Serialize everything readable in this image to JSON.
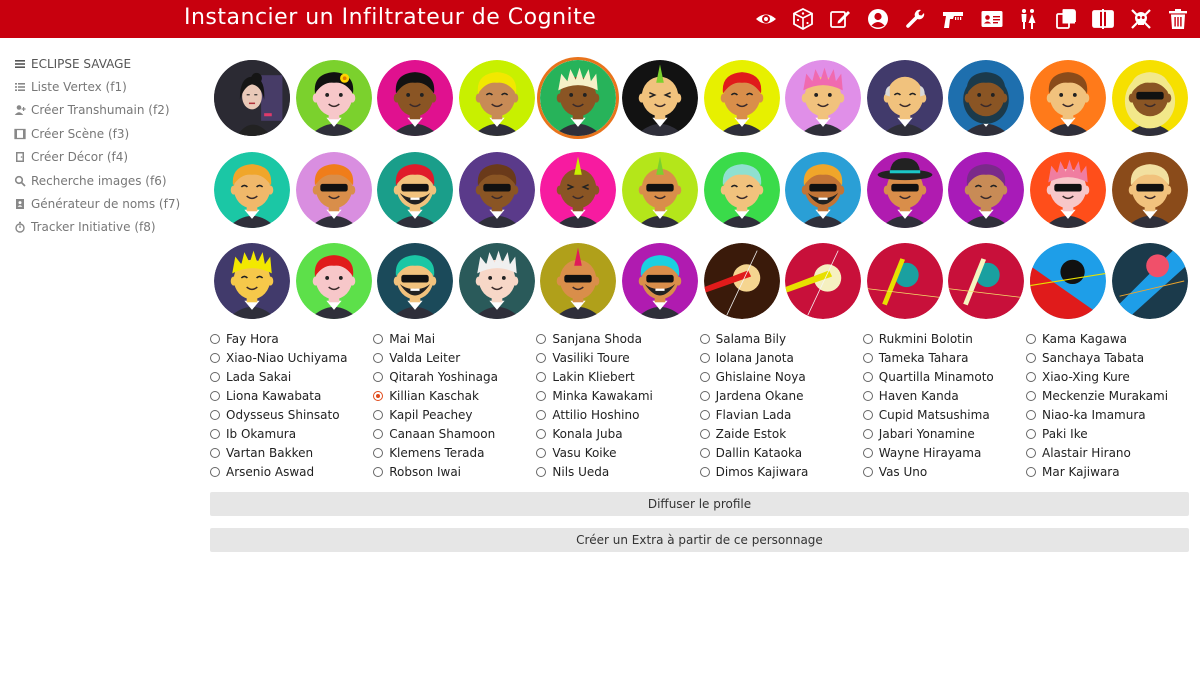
{
  "header": {
    "title": "Instancier un Infiltrateur de Cognite",
    "icons": [
      "eye-icon",
      "dice-icon",
      "edit-icon",
      "user-circle-icon",
      "wrench-icon",
      "gun-icon",
      "id-card-icon",
      "people-icon",
      "copy-icon",
      "split-icon",
      "skull-crossbones-icon",
      "trash-icon"
    ]
  },
  "sidebar": {
    "brand": "ECLIPSE SAVAGE",
    "items": [
      {
        "label": "Liste Vertex (f1)"
      },
      {
        "label": "Créer Transhumain (f2)"
      },
      {
        "label": "Créer Scène (f3)"
      },
      {
        "label": "Créer Décor (f4)"
      },
      {
        "label": "Recherche images (f6)"
      },
      {
        "label": "Générateur de noms (f7)"
      },
      {
        "label": "Tracker Initiative (f8)"
      }
    ]
  },
  "avatars": {
    "selected_index": 4,
    "items": [
      {
        "kind": "photo",
        "bg": "#3d3a44",
        "skin": "#e9c9b8",
        "hair": "#151515"
      },
      {
        "kind": "face",
        "bg": "#7bd12d",
        "skin": "#f7c7c9",
        "hair": "#111111",
        "eyes": "dots",
        "acc": "flower"
      },
      {
        "kind": "face",
        "bg": "#e0118f",
        "skin": "#8a5524",
        "hair": "#121212",
        "eyes": "dots"
      },
      {
        "kind": "face",
        "bg": "#c8f000",
        "skin": "#c88b56",
        "hair": "#f2e800",
        "eyes": "closed"
      },
      {
        "kind": "face",
        "bg": "#27b35a",
        "skin": "#8a5524",
        "hair": "#f6f0c8",
        "eyes": "dots",
        "acc": "spiky"
      },
      {
        "kind": "face",
        "bg": "#121212",
        "skin": "#f1c27d",
        "hair": "#7bd12d",
        "eyes": "squint",
        "acc": "mohawk"
      },
      {
        "kind": "face",
        "bg": "#e7f000",
        "skin": "#d98e4a",
        "hair": "#e01b1b",
        "eyes": "closed"
      },
      {
        "kind": "face",
        "bg": "#e08fe8",
        "skin": "#f1c27d",
        "hair": "#f06ab0",
        "eyes": "dots",
        "acc": "spiky"
      },
      {
        "kind": "face",
        "bg": "#413a6b",
        "skin": "#f1c27d",
        "hair": "#d9d9d9",
        "eyes": "closed",
        "acc": "bald"
      },
      {
        "kind": "face",
        "bg": "#1e6fae",
        "skin": "#8a5524",
        "hair": "#1b3a4b",
        "eyes": "dots",
        "acc": "dreads"
      },
      {
        "kind": "face",
        "bg": "#ff7a1a",
        "skin": "#f1c27d",
        "hair": "#8a4b1a",
        "eyes": "dots"
      },
      {
        "kind": "face",
        "bg": "#f6e000",
        "skin": "#8a5524",
        "hair": "#f2e88a",
        "eyes": "shades",
        "acc": "hood"
      },
      {
        "kind": "face",
        "bg": "#1bc7a5",
        "skin": "#f0b86a",
        "hair": "#f0a62a",
        "eyes": "closed"
      },
      {
        "kind": "face",
        "bg": "#d98ee0",
        "skin": "#d98e4a",
        "hair": "#f07d1a",
        "eyes": "shades"
      },
      {
        "kind": "face",
        "bg": "#1a9e8a",
        "skin": "#f1c27d",
        "hair": "#e01b2b",
        "eyes": "shades",
        "acc": "beard"
      },
      {
        "kind": "face",
        "bg": "#5a3a8a",
        "skin": "#8a5524",
        "hair": "#6a3a1a",
        "eyes": "shades"
      },
      {
        "kind": "face",
        "bg": "#f71ba0",
        "skin": "#8a5524",
        "hair": "#c8f000",
        "eyes": "squint",
        "acc": "mohawk"
      },
      {
        "kind": "face",
        "bg": "#b4e61a",
        "skin": "#d98e4a",
        "hair": "#7bd12d",
        "eyes": "shades",
        "acc": "mohawk"
      },
      {
        "kind": "face",
        "bg": "#3adb4a",
        "skin": "#f1c27d",
        "hair": "#8fe0d0",
        "eyes": "closed"
      },
      {
        "kind": "face",
        "bg": "#2a9fd6",
        "skin": "#c27436",
        "hair": "#f0a62a",
        "eyes": "shades",
        "acc": "beard"
      },
      {
        "kind": "face",
        "bg": "#b01bb0",
        "skin": "#d98e4a",
        "hair": "#222222",
        "eyes": "shades",
        "acc": "hat"
      },
      {
        "kind": "face",
        "bg": "#a81bb8",
        "skin": "#c88b56",
        "hair": "#7a2a8a",
        "eyes": "closed"
      },
      {
        "kind": "face",
        "bg": "#ff4e1a",
        "skin": "#f7c7c9",
        "hair": "#f07da0",
        "eyes": "shades",
        "acc": "spiky"
      },
      {
        "kind": "face",
        "bg": "#8a4b1a",
        "skin": "#f1c27d",
        "hair": "#f2e0a0",
        "eyes": "shades"
      },
      {
        "kind": "face",
        "bg": "#413a6b",
        "skin": "#f6c84a",
        "hair": "#f2e800",
        "eyes": "closed",
        "acc": "spiky"
      },
      {
        "kind": "face",
        "bg": "#5de04a",
        "skin": "#f7c7c9",
        "hair": "#e01b1b",
        "eyes": "dots"
      },
      {
        "kind": "face",
        "bg": "#1b4a5a",
        "skin": "#f1c27d",
        "hair": "#1bc7a5",
        "eyes": "shades",
        "acc": "beard"
      },
      {
        "kind": "face",
        "bg": "#2a5a5a",
        "skin": "#f7d7c7",
        "hair": "#f0f0f0",
        "eyes": "dots",
        "acc": "spiky"
      },
      {
        "kind": "face",
        "bg": "#b0a01a",
        "skin": "#d98e4a",
        "hair": "#e01b5a",
        "eyes": "shades",
        "acc": "mohawk"
      },
      {
        "kind": "face",
        "bg": "#b01bb0",
        "skin": "#d98e4a",
        "hair": "#1bd0e0",
        "eyes": "shades",
        "acc": "beard"
      },
      {
        "kind": "abstract",
        "bg": "#3a1a0a",
        "a": "#f5d590",
        "b": "#e01b1b",
        "style": "circle"
      },
      {
        "kind": "abstract",
        "bg": "#c8103a",
        "a": "#f5f0c0",
        "b": "#e8e000",
        "style": "circle"
      },
      {
        "kind": "abstract",
        "bg": "#c8103a",
        "a": "#1aa0a0",
        "b": "#e8e000",
        "style": "teal"
      },
      {
        "kind": "abstract",
        "bg": "#c8103a",
        "a": "#1aa0a0",
        "b": "#f5f5c0",
        "style": "teal"
      },
      {
        "kind": "abstract",
        "bg": "#1e9ee8",
        "a": "#111111",
        "b": "#e8e000",
        "style": "dark"
      },
      {
        "kind": "abstract",
        "bg": "#1b3a4b",
        "a": "#f0506a",
        "b": "#1e9ee8",
        "style": "stripe"
      }
    ]
  },
  "names": {
    "selected": "Killian Kaschak",
    "columns": [
      [
        "Fay Hora",
        "Xiao-Niao Uchiyama",
        "Lada Sakai",
        "Liona Kawabata",
        "Odysseus Shinsato",
        "Ib Okamura",
        "Vartan Bakken",
        "Arsenio Aswad"
      ],
      [
        "Mai Mai",
        "Valda Leiter",
        "Qitarah Yoshinaga",
        "Killian Kaschak",
        "Kapil Peachey",
        "Canaan Shamoon",
        "Klemens Terada",
        "Robson Iwai"
      ],
      [
        "Sanjana Shoda",
        "Vasiliki Toure",
        "Lakin Kliebert",
        "Minka Kawakami",
        "Attilio Hoshino",
        "Konala Juba",
        "Vasu Koike",
        "Nils Ueda"
      ],
      [
        "Salama Bily",
        "Iolana Janota",
        "Ghislaine Noya",
        "Jardena Okane",
        "Flavian Lada",
        "Zaide Estok",
        "Dallin Kataoka",
        "Dimos Kajiwara"
      ],
      [
        "Rukmini Bolotin",
        "Tameka Tahara",
        "Quartilla Minamoto",
        "Haven Kanda",
        "Cupid Matsushima",
        "Jabari Yonamine",
        "Wayne Hirayama",
        "Vas Uno"
      ],
      [
        "Kama Kagawa",
        "Sanchaya Tabata",
        "Xiao-Xing Kure",
        "Meckenzie Murakami",
        "Niao-ka Imamura",
        "Paki Ike",
        "Alastair Hirano",
        "Mar Kajiwara"
      ]
    ]
  },
  "buttons": {
    "diffuse": "Diffuser le profile",
    "extra": "Créer un Extra à partir de ce personnage"
  }
}
